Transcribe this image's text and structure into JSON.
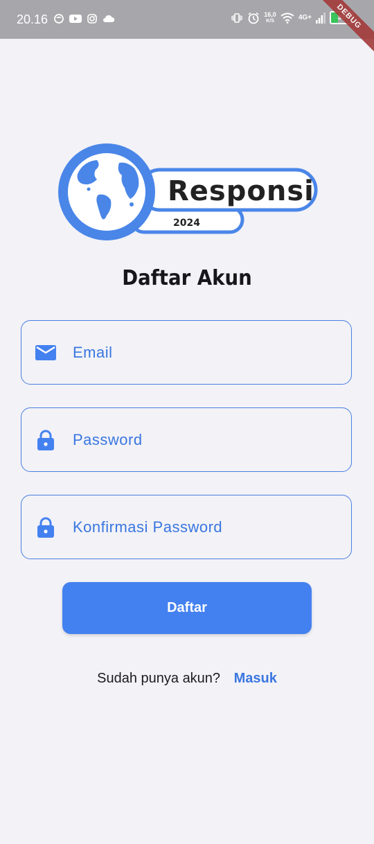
{
  "status_bar": {
    "time": "20.16",
    "speed_value": "16,0",
    "speed_unit": "K/S",
    "network": "4G+",
    "battery": "34",
    "battery_level": 0.34,
    "debug_label": "DEBUG"
  },
  "logo": {
    "brand": "Responsi",
    "year": "2024",
    "accent_color": "#4a86e8"
  },
  "page": {
    "title": "Daftar Akun"
  },
  "form": {
    "email": {
      "placeholder": "Email",
      "icon": "mail-icon"
    },
    "password": {
      "placeholder": "Password",
      "icon": "lock-icon"
    },
    "confirm_password": {
      "placeholder": "Konfirmasi Password",
      "icon": "lock-icon"
    },
    "submit_label": "Daftar"
  },
  "footer": {
    "question": "Sudah punya akun?",
    "link_label": "Masuk"
  },
  "colors": {
    "primary": "#4481f0",
    "background": "#f2f2f7",
    "status_bar": "#a7a7ab"
  }
}
